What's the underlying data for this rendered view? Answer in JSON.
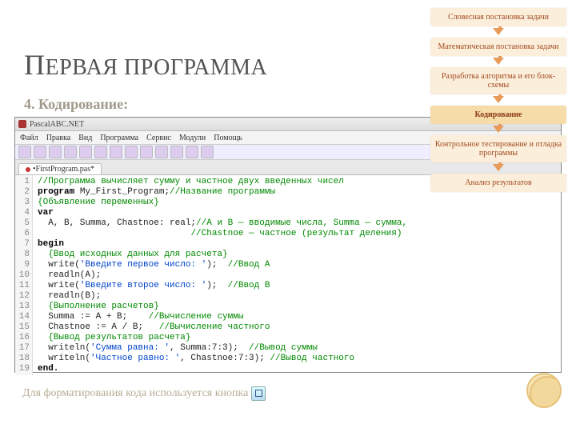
{
  "title": {
    "big": "П",
    "rest": "ЕРВАЯ ПРОГРАММА"
  },
  "subtitle": "4. Кодирование:",
  "ide": {
    "app_name": "PascalABC.NET",
    "menu": [
      "Файл",
      "Правка",
      "Вид",
      "Программа",
      "Сервис",
      "Модули",
      "Помощь"
    ],
    "tab_label": "•FirstProgram.pas*",
    "lines": [
      {
        "n": "1",
        "frags": [
          {
            "t": "//Программа вычисляет сумму и частное двух введенных чисел",
            "c": "cm"
          }
        ]
      },
      {
        "n": "2",
        "frags": [
          {
            "t": "program ",
            "c": "kw"
          },
          {
            "t": "My_First_Program;",
            "c": "id"
          },
          {
            "t": "//Название программы",
            "c": "cm"
          }
        ]
      },
      {
        "n": "3",
        "frags": [
          {
            "t": "{Объявление переменных}",
            "c": "cm"
          }
        ]
      },
      {
        "n": "4",
        "frags": [
          {
            "t": "var",
            "c": "kw"
          }
        ]
      },
      {
        "n": "5",
        "frags": [
          {
            "t": "  A, B, Summa, Chastnoe: real;",
            "c": "id"
          },
          {
            "t": "//A и B — вводимые числа, Summa — сумма,",
            "c": "cm"
          }
        ]
      },
      {
        "n": "6",
        "frags": [
          {
            "t": "                             ",
            "c": "id"
          },
          {
            "t": "//Chastnoe — частное (результат деления)",
            "c": "cm"
          }
        ]
      },
      {
        "n": "7",
        "frags": [
          {
            "t": "begin",
            "c": "kw"
          }
        ]
      },
      {
        "n": "8",
        "frags": [
          {
            "t": "  {Ввод исходных данных для расчета}",
            "c": "cm"
          }
        ]
      },
      {
        "n": "9",
        "frags": [
          {
            "t": "  write(",
            "c": "id"
          },
          {
            "t": "'Введите первое число: '",
            "c": "str"
          },
          {
            "t": ");  ",
            "c": "id"
          },
          {
            "t": "//Ввод A",
            "c": "cm"
          }
        ]
      },
      {
        "n": "10",
        "frags": [
          {
            "t": "  readln(A);",
            "c": "id"
          }
        ]
      },
      {
        "n": "11",
        "frags": [
          {
            "t": "  write(",
            "c": "id"
          },
          {
            "t": "'Введите второе число: '",
            "c": "str"
          },
          {
            "t": ");  ",
            "c": "id"
          },
          {
            "t": "//Ввод B",
            "c": "cm"
          }
        ]
      },
      {
        "n": "12",
        "frags": [
          {
            "t": "  readln(B);",
            "c": "id"
          }
        ]
      },
      {
        "n": "13",
        "frags": [
          {
            "t": "  {Выполнение расчетов}",
            "c": "cm"
          }
        ]
      },
      {
        "n": "14",
        "frags": [
          {
            "t": "  Summa := A + B;    ",
            "c": "id"
          },
          {
            "t": "//Вычисление суммы",
            "c": "cm"
          }
        ]
      },
      {
        "n": "15",
        "frags": [
          {
            "t": "  Chastnoe := A / B;   ",
            "c": "id"
          },
          {
            "t": "//Вычисление частного",
            "c": "cm"
          }
        ]
      },
      {
        "n": "16",
        "frags": [
          {
            "t": "  {Вывод результатов расчета}",
            "c": "cm"
          }
        ]
      },
      {
        "n": "17",
        "frags": [
          {
            "t": "  writeln(",
            "c": "id"
          },
          {
            "t": "'Сумма равна: '",
            "c": "str"
          },
          {
            "t": ", Summa:7:3);  ",
            "c": "id"
          },
          {
            "t": "//Вывод суммы",
            "c": "cm"
          }
        ]
      },
      {
        "n": "18",
        "frags": [
          {
            "t": "  writeln(",
            "c": "id"
          },
          {
            "t": "'Частное равно: '",
            "c": "str"
          },
          {
            "t": ", Chastnoe:7:3); ",
            "c": "id"
          },
          {
            "t": "//Вывод частного",
            "c": "cm"
          }
        ]
      },
      {
        "n": "19",
        "frags": [
          {
            "t": "end.",
            "c": "kw"
          }
        ]
      }
    ]
  },
  "footer": "Для форматирования кода используется кнопка",
  "flow": {
    "steps": [
      "Словесная постановка задачи",
      "Математическая постановка задачи",
      "Разработка алгоритма и его блок-схемы",
      "Кодирование",
      "Контрольное тестирование и отладка программы",
      "Анализ результатов"
    ],
    "active_index": 3
  }
}
